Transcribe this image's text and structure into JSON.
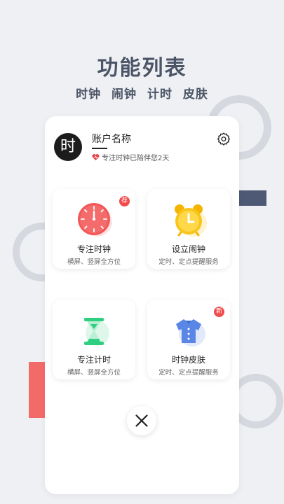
{
  "hero": {
    "title": "功能列表",
    "subtitles": [
      "时钟",
      "闹钟",
      "计时",
      "皮肤"
    ]
  },
  "account": {
    "avatar_char": "时",
    "name": "账户名称",
    "info": "专注时钟已陪伴您2天"
  },
  "tiles": [
    {
      "title": "专注时钟",
      "desc": "横屏、竖屏全方位",
      "badge": "荐",
      "icon": "clock-icon"
    },
    {
      "title": "设立闹钟",
      "desc": "定时、定点提醒服务",
      "badge": "",
      "icon": "alarm-clock-icon"
    },
    {
      "title": "专注计时",
      "desc": "横屏、竖屏全方位",
      "badge": "",
      "icon": "hourglass-icon"
    },
    {
      "title": "时钟皮肤",
      "desc": "定时、定点提醒服务",
      "badge": "新",
      "icon": "shirt-icon"
    }
  ],
  "colors": {
    "background": "#eef0f4",
    "heading": "#4b5566",
    "badge": "#f24a4a",
    "accent_navy": "#4e5a75",
    "accent_red": "#f36b69"
  }
}
